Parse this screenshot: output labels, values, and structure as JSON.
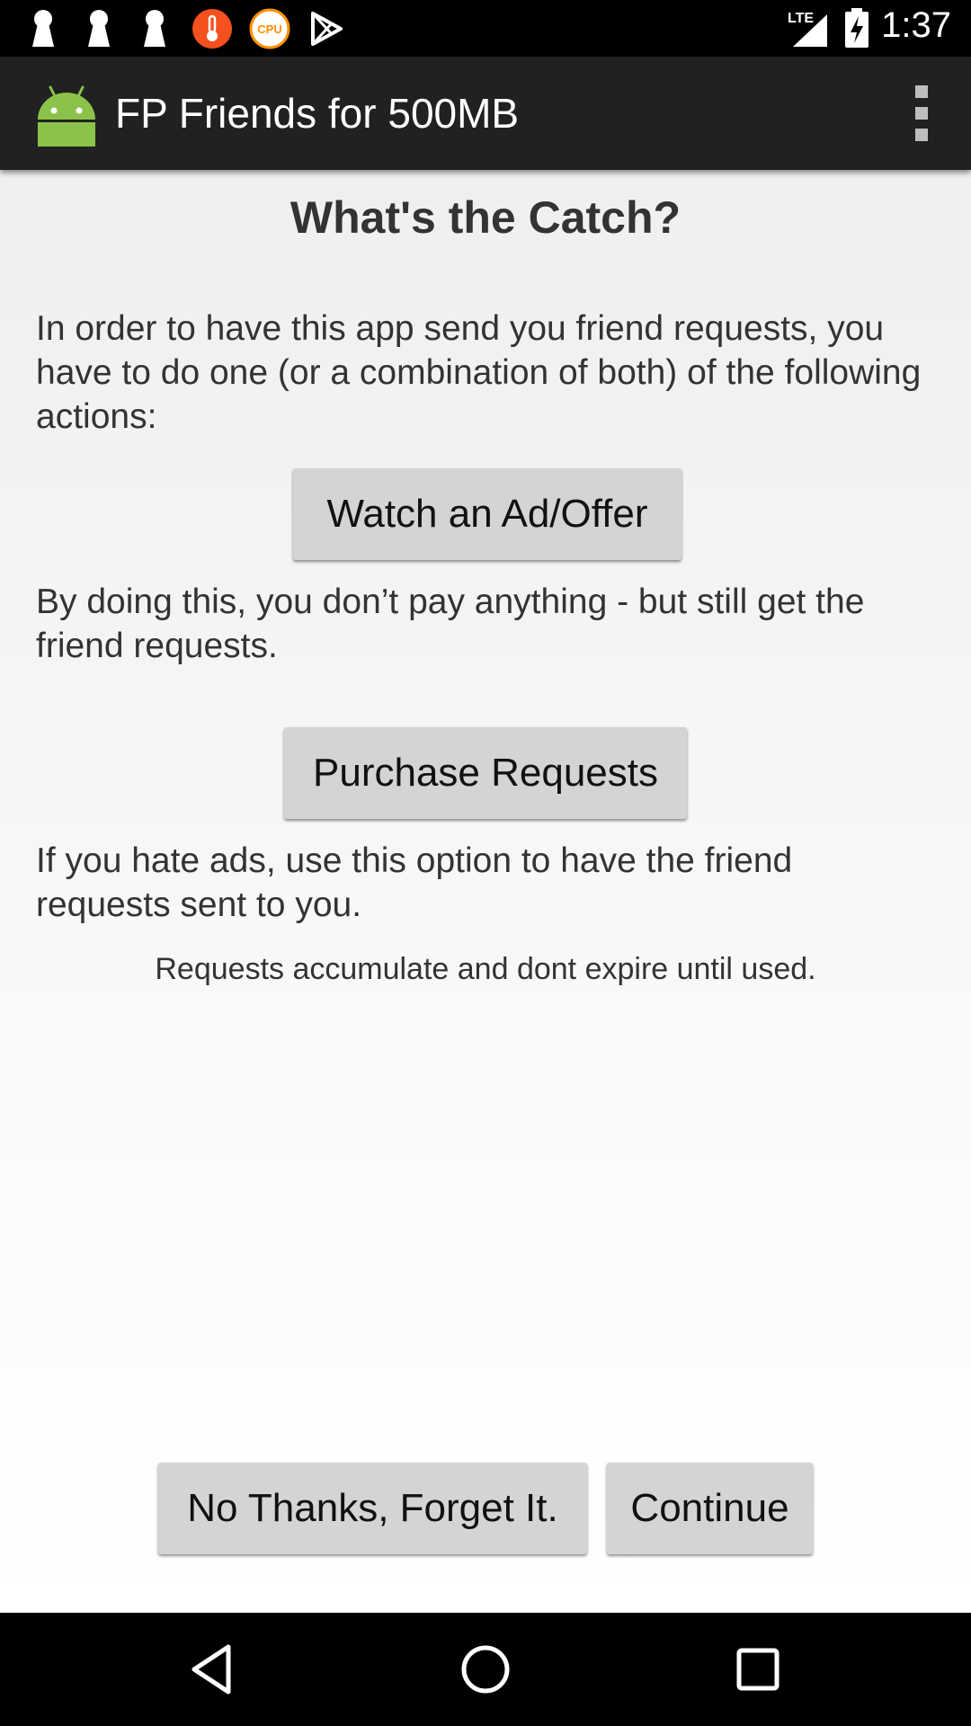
{
  "status_bar": {
    "time": "1:37",
    "network": "LTE",
    "icons": [
      "keyhole-icon",
      "keyhole-icon",
      "keyhole-icon",
      "thermometer-icon",
      "cpu-icon",
      "play-store-icon",
      "signal-icon",
      "battery-charging-icon"
    ],
    "cpu_label": "CPU"
  },
  "app_bar": {
    "title": "FP Friends for 500MB",
    "icon": "android-icon",
    "menu_icon": "overflow-menu-icon"
  },
  "main": {
    "heading": "What's the Catch?",
    "intro": "In order to have this app send you friend requests, you have to do one (or a combination of both) of the following actions:",
    "watch_button": "Watch an Ad/Offer",
    "watch_desc": "By doing this, you don’t pay anything - but still get the friend requests.",
    "purchase_button": "Purchase Requests",
    "purchase_desc": "If you hate ads, use this option to have the friend requests sent to you.",
    "note": "Requests accumulate and dont expire until used."
  },
  "footer": {
    "no_thanks_button": "No Thanks, Forget It.",
    "continue_button": "Continue"
  },
  "nav_bar": {
    "back_icon": "back-icon",
    "home_icon": "home-icon",
    "recents_icon": "recents-icon"
  },
  "colors": {
    "app_bar": "#212121",
    "button": "#d4d4d4",
    "android_green": "#8bc34a",
    "thermo_red": "#f4511e",
    "cpu_orange": "#ff8f00"
  }
}
